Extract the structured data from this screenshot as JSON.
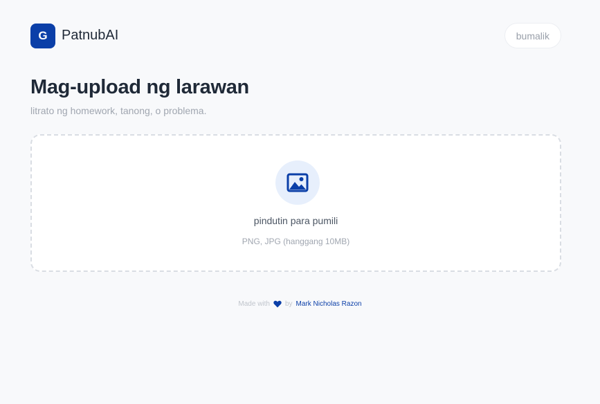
{
  "header": {
    "logo_letter": "G",
    "app_name": "PatnubAI",
    "back_label": "bumalik"
  },
  "main": {
    "title": "Mag-upload ng larawan",
    "subtitle": "litrato ng homework, tanong, o problema.",
    "dropzone": {
      "icon": "image-icon",
      "label": "pindutin para pumili",
      "hint": "PNG, JPG (hanggang 10MB)"
    }
  },
  "footer": {
    "made_with": "Made with",
    "heart_icon": "heart-icon",
    "by": "by",
    "author": "Mark Nicholas Razon"
  },
  "colors": {
    "brand": "#0b3fa8",
    "background": "#f8f9fb",
    "icon_bg": "#e7effc"
  }
}
